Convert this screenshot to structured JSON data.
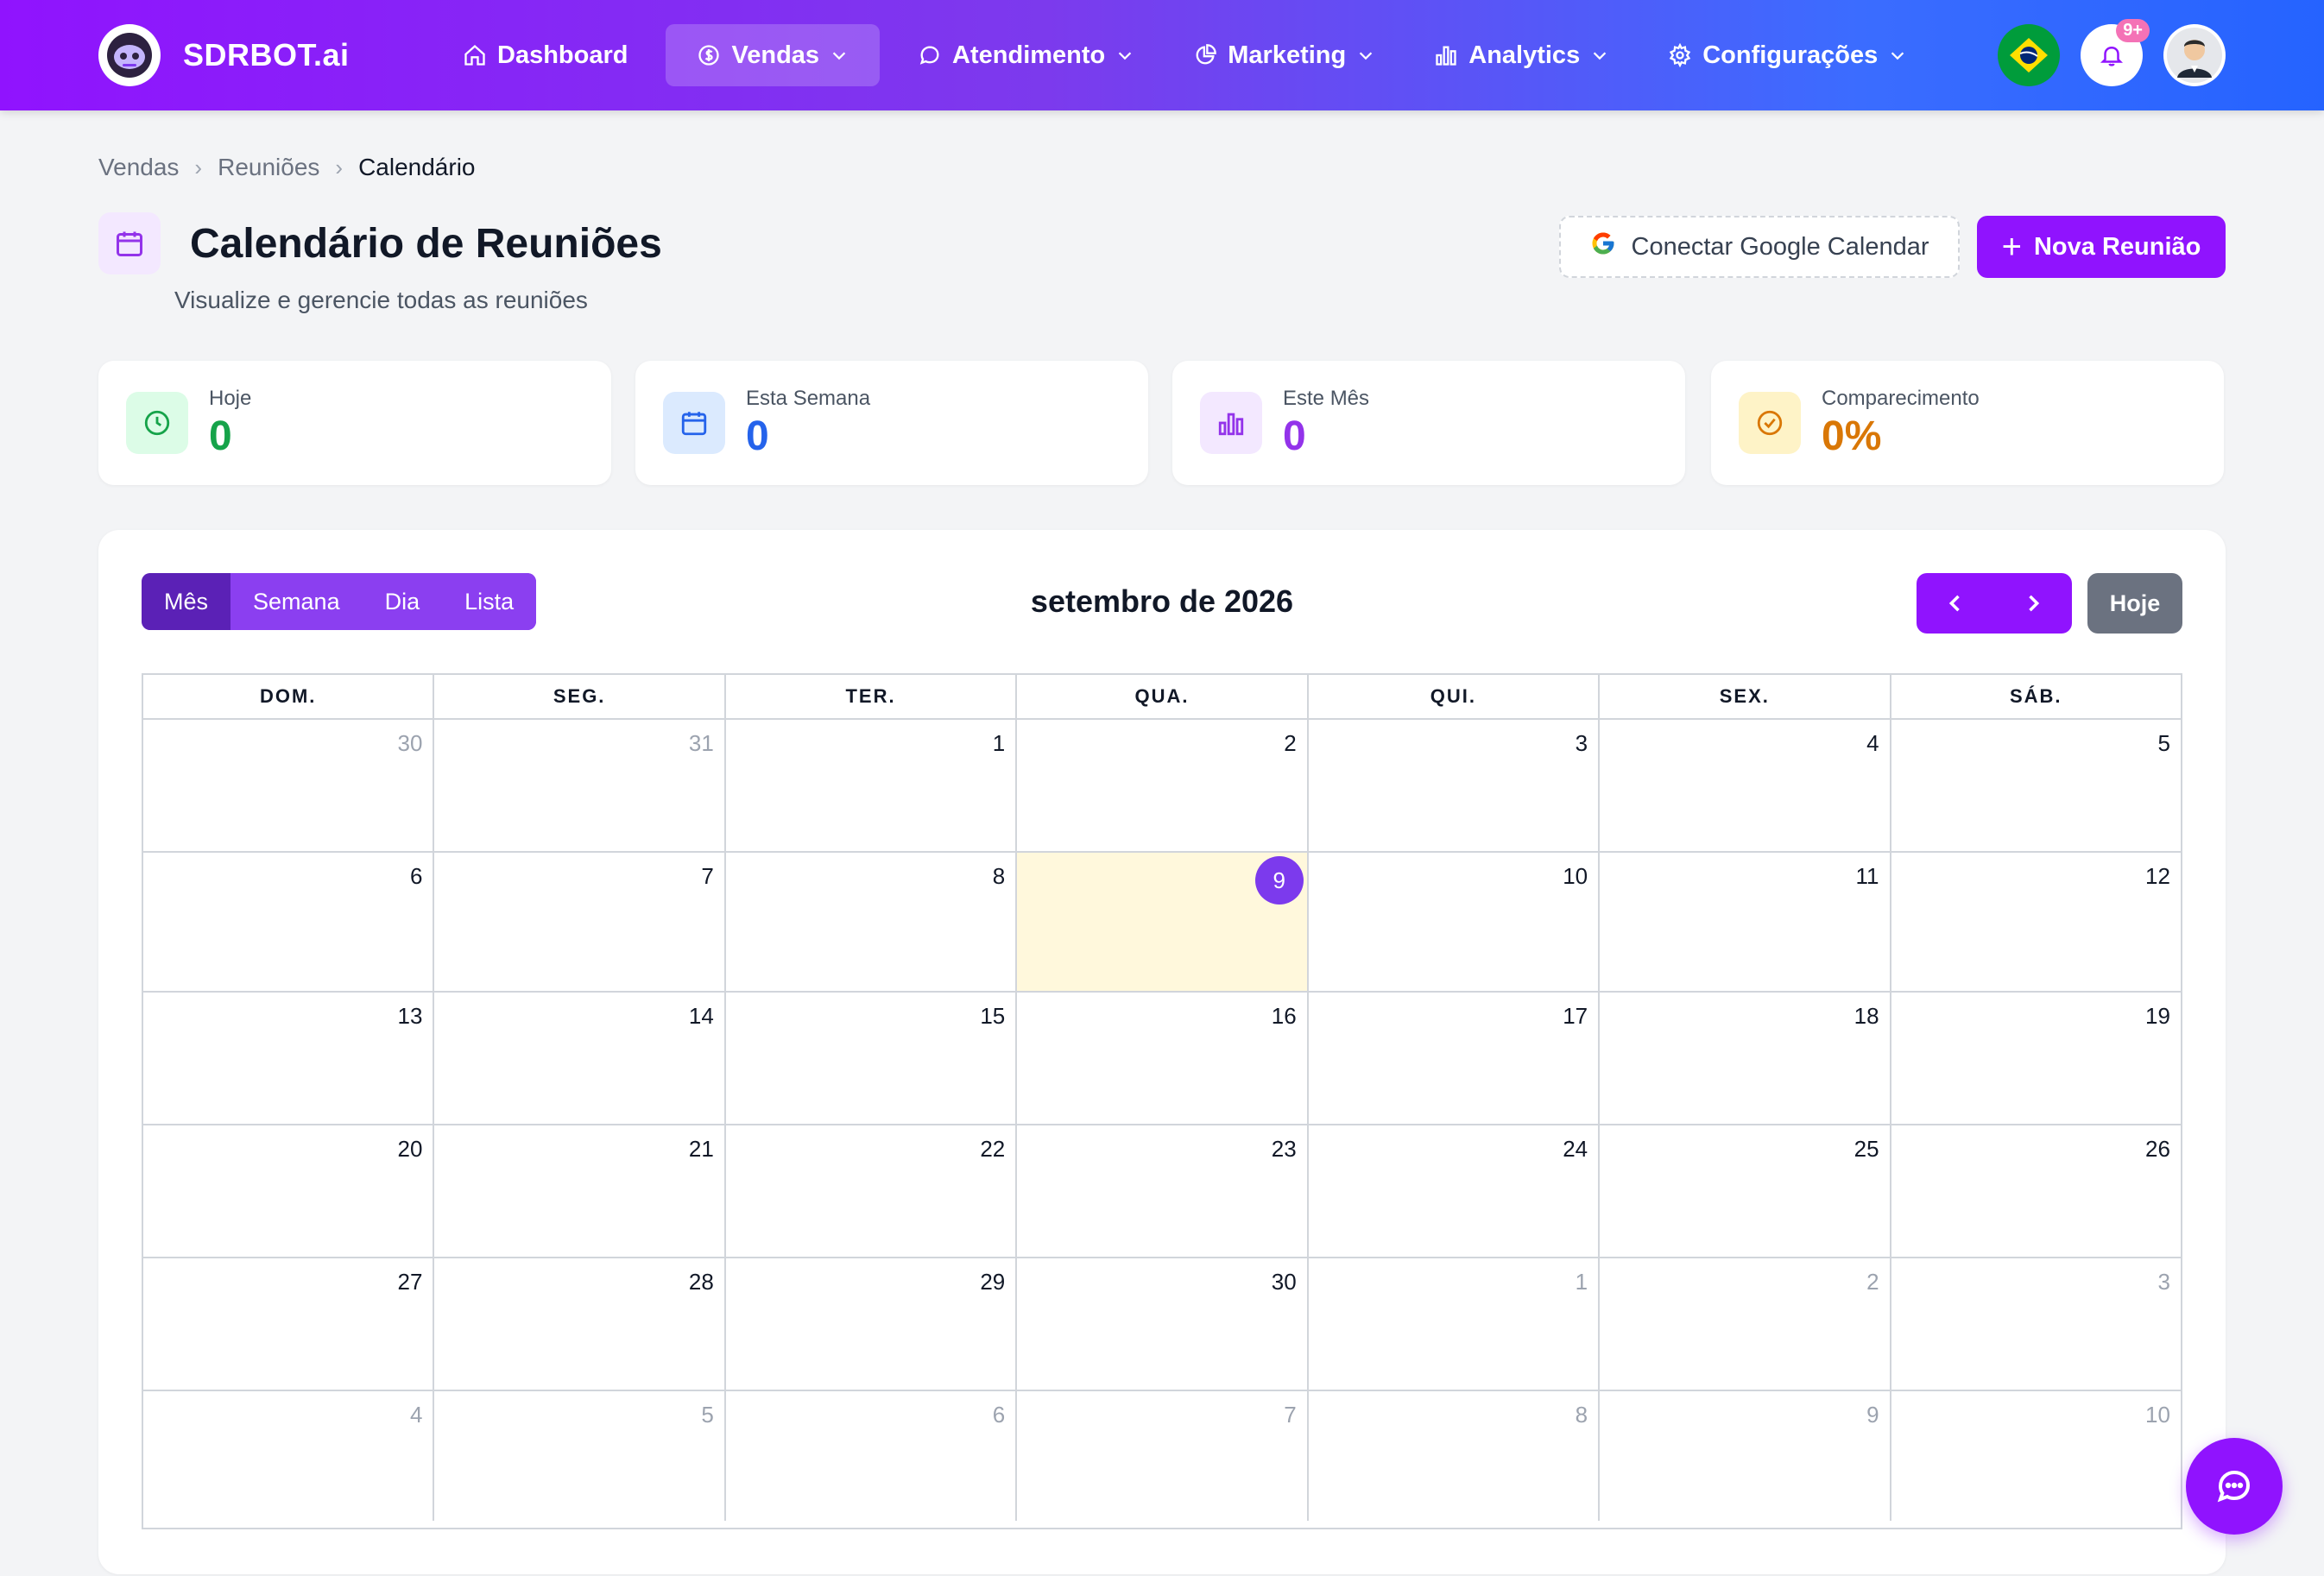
{
  "app": {
    "name": "SDRBOT.ai"
  },
  "nav": {
    "items": [
      {
        "label": "Dashboard",
        "icon": "home-icon",
        "dropdown": false,
        "active": false
      },
      {
        "label": "Vendas",
        "icon": "dollar-icon",
        "dropdown": true,
        "active": true
      },
      {
        "label": "Atendimento",
        "icon": "chat-icon",
        "dropdown": true,
        "active": false
      },
      {
        "label": "Marketing",
        "icon": "pie-chart-icon",
        "dropdown": true,
        "active": false
      },
      {
        "label": "Analytics",
        "icon": "bar-chart-icon",
        "dropdown": true,
        "active": false
      },
      {
        "label": "Configurações",
        "icon": "gear-icon",
        "dropdown": true,
        "active": false
      }
    ],
    "notifications_badge": "9+"
  },
  "breadcrumb": [
    "Vendas",
    "Reuniões",
    "Calendário"
  ],
  "page": {
    "title": "Calendário de Reuniões",
    "subtitle": "Visualize e gerencie todas as reuniões",
    "google_button": "Conectar Google Calendar",
    "new_button": "Nova Reunião"
  },
  "stats": [
    {
      "label": "Hoje",
      "value": "0",
      "color": "#16a34a",
      "bg": "#dcfce7",
      "icon": "clock-icon"
    },
    {
      "label": "Esta Semana",
      "value": "0",
      "color": "#2563eb",
      "bg": "#dbeafe",
      "icon": "calendar-icon"
    },
    {
      "label": "Este Mês",
      "value": "0",
      "color": "#9333ea",
      "bg": "#f3e8ff",
      "icon": "bar-chart-icon"
    },
    {
      "label": "Comparecimento",
      "value": "0%",
      "color": "#d97706",
      "bg": "#fef3c7",
      "icon": "check-circle-icon"
    }
  ],
  "calendar": {
    "views": [
      "Mês",
      "Semana",
      "Dia",
      "Lista"
    ],
    "active_view": "Mês",
    "month_title": "setembro de 2026",
    "today_label": "Hoje",
    "weekdays": [
      "DOM.",
      "SEG.",
      "TER.",
      "QUA.",
      "QUI.",
      "SEX.",
      "SÁB."
    ],
    "weeks": [
      [
        {
          "d": "30",
          "o": true
        },
        {
          "d": "31",
          "o": true
        },
        {
          "d": "1"
        },
        {
          "d": "2"
        },
        {
          "d": "3"
        },
        {
          "d": "4"
        },
        {
          "d": "5"
        }
      ],
      [
        {
          "d": "6"
        },
        {
          "d": "7"
        },
        {
          "d": "8"
        },
        {
          "d": "9",
          "today": true
        },
        {
          "d": "10"
        },
        {
          "d": "11"
        },
        {
          "d": "12"
        }
      ],
      [
        {
          "d": "13"
        },
        {
          "d": "14"
        },
        {
          "d": "15"
        },
        {
          "d": "16"
        },
        {
          "d": "17"
        },
        {
          "d": "18"
        },
        {
          "d": "19"
        }
      ],
      [
        {
          "d": "20"
        },
        {
          "d": "21"
        },
        {
          "d": "22"
        },
        {
          "d": "23"
        },
        {
          "d": "24"
        },
        {
          "d": "25"
        },
        {
          "d": "26"
        }
      ],
      [
        {
          "d": "27"
        },
        {
          "d": "28"
        },
        {
          "d": "29"
        },
        {
          "d": "30"
        },
        {
          "d": "1",
          "o": true
        },
        {
          "d": "2",
          "o": true
        },
        {
          "d": "3",
          "o": true
        }
      ],
      [
        {
          "d": "4",
          "o": true
        },
        {
          "d": "5",
          "o": true
        },
        {
          "d": "6",
          "o": true
        },
        {
          "d": "7",
          "o": true
        },
        {
          "d": "8",
          "o": true
        },
        {
          "d": "9",
          "o": true
        },
        {
          "d": "10",
          "o": true
        }
      ]
    ]
  },
  "colors": {
    "brand": "#9013fe",
    "today_bg": "#fff8dc",
    "today_marker": "#7c3aed"
  }
}
